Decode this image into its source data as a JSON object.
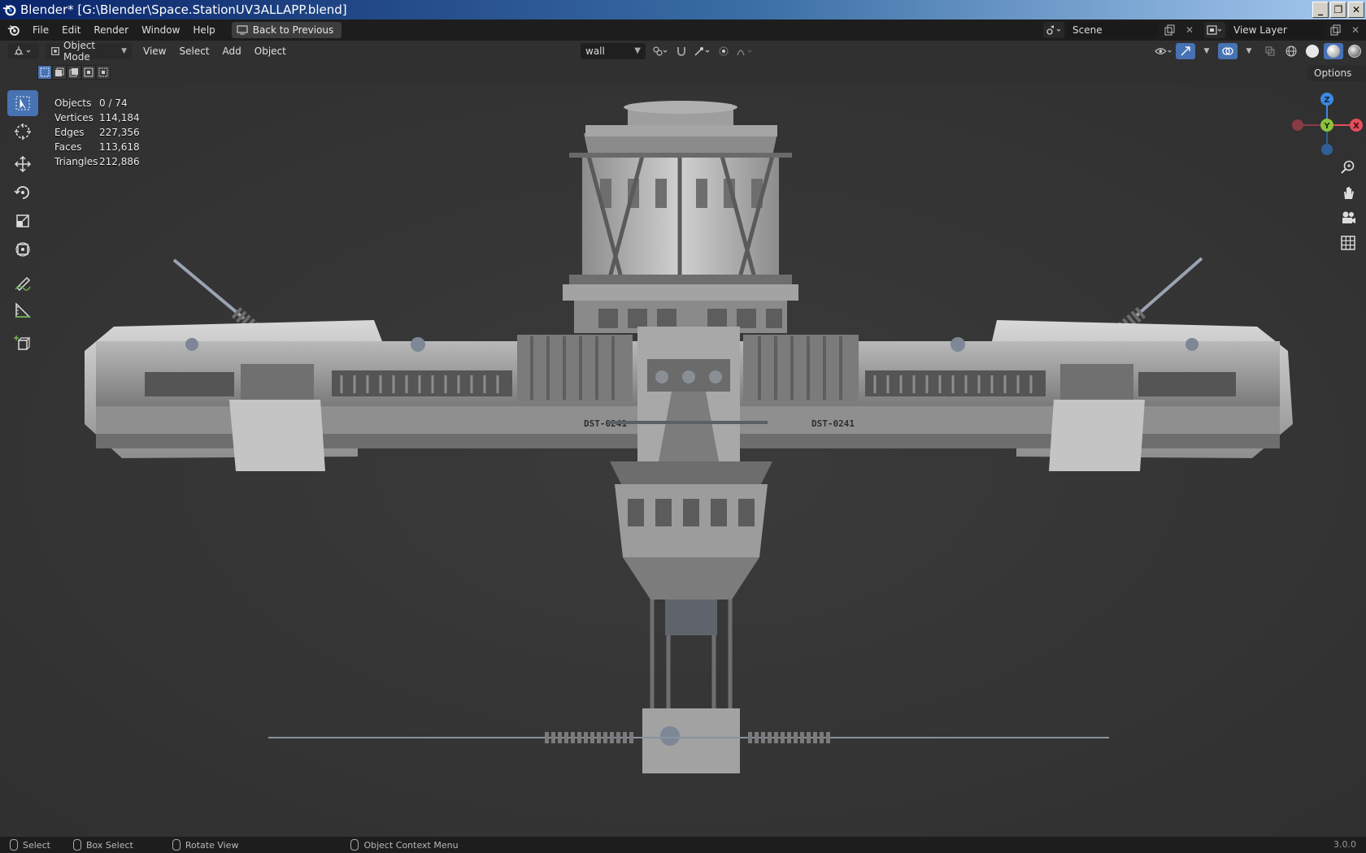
{
  "window": {
    "title": "Blender* [G:\\Blender\\Space.StationUV3ALLAPP.blend]",
    "minimize": "_",
    "restore": "❐",
    "close": "✕"
  },
  "menubar": {
    "items": [
      "File",
      "Edit",
      "Render",
      "Window",
      "Help"
    ],
    "back_button": "Back to Previous",
    "scene": "Scene",
    "view_layer": "View Layer"
  },
  "viewport_header": {
    "mode": "Object Mode",
    "menus": [
      "View",
      "Select",
      "Add",
      "Object"
    ],
    "object_dropdown": "wall"
  },
  "tool_settings": {
    "options": "Options"
  },
  "stats": {
    "rows": [
      {
        "label": "Objects",
        "value": "0 / 74"
      },
      {
        "label": "Vertices",
        "value": "114,184"
      },
      {
        "label": "Edges",
        "value": "227,356"
      },
      {
        "label": "Faces",
        "value": "113,618"
      },
      {
        "label": "Triangles",
        "value": "212,886"
      }
    ]
  },
  "gizmo": {
    "x_label": "X",
    "y_label": "Y",
    "z_label": "Z"
  },
  "model_labels": {
    "left_hull_code": "DST-0241",
    "right_hull_code": "DST-0241"
  },
  "statusbar": {
    "select": "Select",
    "box_select": "Box Select",
    "rotate_view": "Rotate View",
    "context_menu": "Object Context Menu",
    "version": "3.0.0"
  },
  "colors": {
    "accent": "#4772b3",
    "axis_x": "#e34d5c",
    "axis_y": "#8ac23d",
    "axis_z": "#3e89e0"
  }
}
